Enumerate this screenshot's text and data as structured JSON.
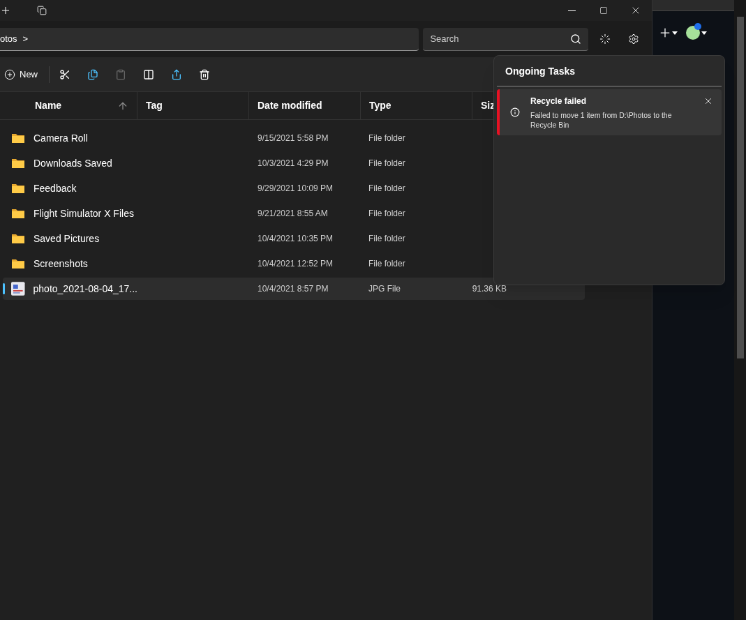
{
  "address_bar": {
    "breadcrumb": "otos",
    "separator": ">"
  },
  "search": {
    "placeholder": "Search"
  },
  "toolbar": {
    "new_label": "New"
  },
  "table": {
    "columns": [
      "Name",
      "Tag",
      "Date modified",
      "Type",
      "Siz"
    ],
    "rows": [
      {
        "kind": "folder",
        "name": "Camera Roll",
        "date": "9/15/2021 5:58 PM",
        "type": "File folder",
        "size": "",
        "selected": false
      },
      {
        "kind": "folder",
        "name": "Downloads Saved",
        "date": "10/3/2021 4:29 PM",
        "type": "File folder",
        "size": "",
        "selected": false
      },
      {
        "kind": "folder",
        "name": "Feedback",
        "date": "9/29/2021 10:09 PM",
        "type": "File folder",
        "size": "",
        "selected": false
      },
      {
        "kind": "folder",
        "name": "Flight Simulator X Files",
        "date": "9/21/2021 8:55 AM",
        "type": "File folder",
        "size": "",
        "selected": false
      },
      {
        "kind": "folder",
        "name": "Saved Pictures",
        "date": "10/4/2021 10:35 PM",
        "type": "File folder",
        "size": "",
        "selected": false
      },
      {
        "kind": "folder",
        "name": "Screenshots",
        "date": "10/4/2021 12:52 PM",
        "type": "File folder",
        "size": "",
        "selected": false
      },
      {
        "kind": "image",
        "name": "photo_2021-08-04_17...",
        "date": "10/4/2021 8:57 PM",
        "type": "JPG File",
        "size": "91.36 KB",
        "selected": true
      }
    ]
  },
  "ongoing_tasks": {
    "title": "Ongoing Tasks",
    "tasks": [
      {
        "title": "Recycle failed",
        "message": "Failed to move 1 item from D:\\Photos to the Recycle Bin",
        "color": "#e81123"
      }
    ]
  }
}
